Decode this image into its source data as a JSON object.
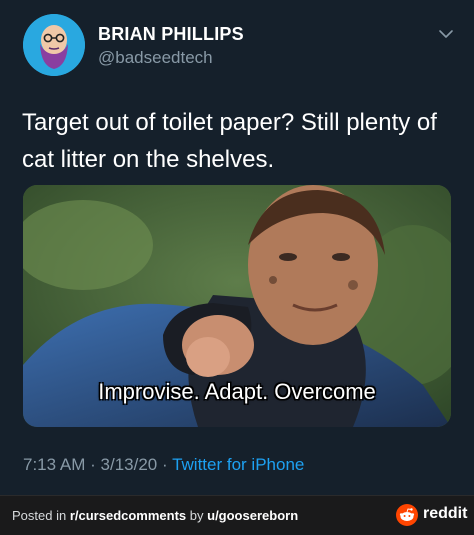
{
  "tweet": {
    "author_name": "BRIAN PHILLIPS",
    "author_handle": "@badseedtech",
    "text": "Target out of toilet paper? Still plenty of cat litter on the shelves.",
    "media_caption": "Improvise. Adapt. Overcome",
    "time": "7:13 AM",
    "date": "3/13/20",
    "source": "Twitter for iPhone",
    "sep": "·"
  },
  "footer": {
    "prefix": "Posted in ",
    "subreddit": "r/cursedcomments",
    "by": " by ",
    "user": "u/goosereborn",
    "brand": "reddit"
  },
  "colors": {
    "background": "#15202b",
    "secondary_text": "#8899a6",
    "link": "#1da1f2",
    "reddit_orange": "#ff4500"
  },
  "icons": {
    "chevron": "chevron-down-icon",
    "reddit": "reddit-alien-icon"
  }
}
